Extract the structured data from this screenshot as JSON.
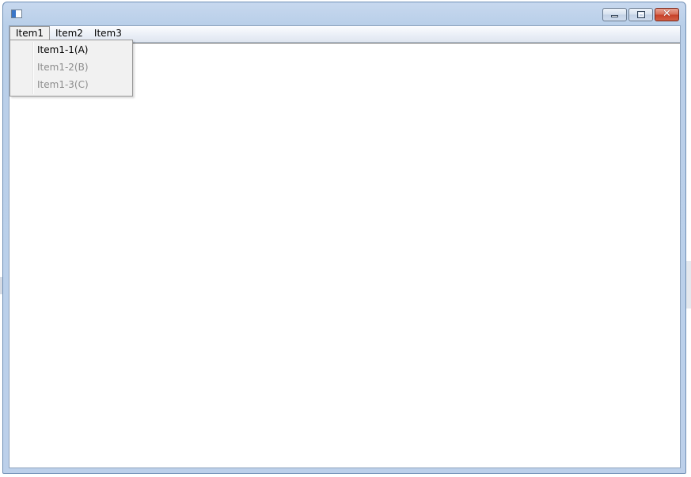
{
  "window": {
    "title": "",
    "icon": "app-window-icon",
    "caption_buttons": {
      "minimize": "minimize-icon",
      "maximize": "maximize-icon",
      "close_glyph": "✕"
    }
  },
  "menubar": {
    "items": [
      {
        "label": "Item1",
        "open": true
      },
      {
        "label": "Item2",
        "open": false
      },
      {
        "label": "Item3",
        "open": false
      }
    ]
  },
  "dropdown": {
    "items": [
      {
        "label": "Item1-1(A)",
        "enabled": true
      },
      {
        "label": "Item1-2(B)",
        "enabled": false
      },
      {
        "label": "Item1-3(C)",
        "enabled": false
      }
    ]
  },
  "colors": {
    "frame": "#bcd0ea",
    "close_button": "#c7422a",
    "menu_background": "#f1f1f1",
    "disabled_text": "#8d8d8d"
  }
}
